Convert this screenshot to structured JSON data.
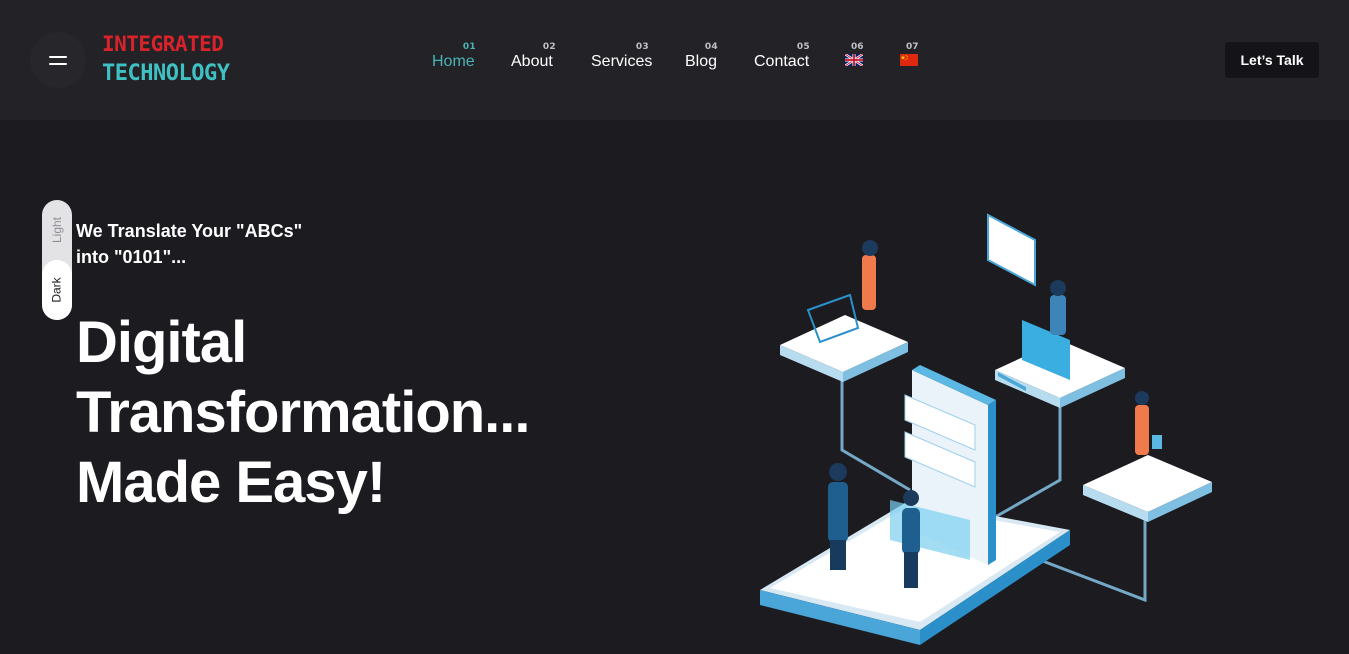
{
  "header": {
    "logo": {
      "line1": "INTEGRATED",
      "line2": "TECHNOLOGY"
    },
    "menu_icon": "hamburger-menu-icon",
    "nav": [
      {
        "num": "01",
        "label": "Home",
        "active": true
      },
      {
        "num": "02",
        "label": "About",
        "active": false
      },
      {
        "num": "03",
        "label": "Services",
        "active": false
      },
      {
        "num": "04",
        "label": "Blog",
        "active": false
      },
      {
        "num": "05",
        "label": "Contact",
        "active": false
      }
    ],
    "languages": [
      {
        "num": "06",
        "icon": "uk-flag-icon"
      },
      {
        "num": "07",
        "icon": "china-flag-icon"
      }
    ],
    "cta_label": "Let’s Talk"
  },
  "theme_toggle": {
    "light": "Light",
    "dark": "Dark",
    "selected": "Dark"
  },
  "hero": {
    "tagline": "We Translate Your \"ABCs\" into \"0101\"...",
    "headline_line1": "Digital",
    "headline_line2": "Transformation...",
    "headline_line3": "Made Easy!"
  },
  "colors": {
    "background": "#1b1b20",
    "header_bg": "#222227",
    "accent": "#4ab3b5",
    "logo_red": "#d8232a",
    "logo_teal": "#3fc0c3"
  }
}
